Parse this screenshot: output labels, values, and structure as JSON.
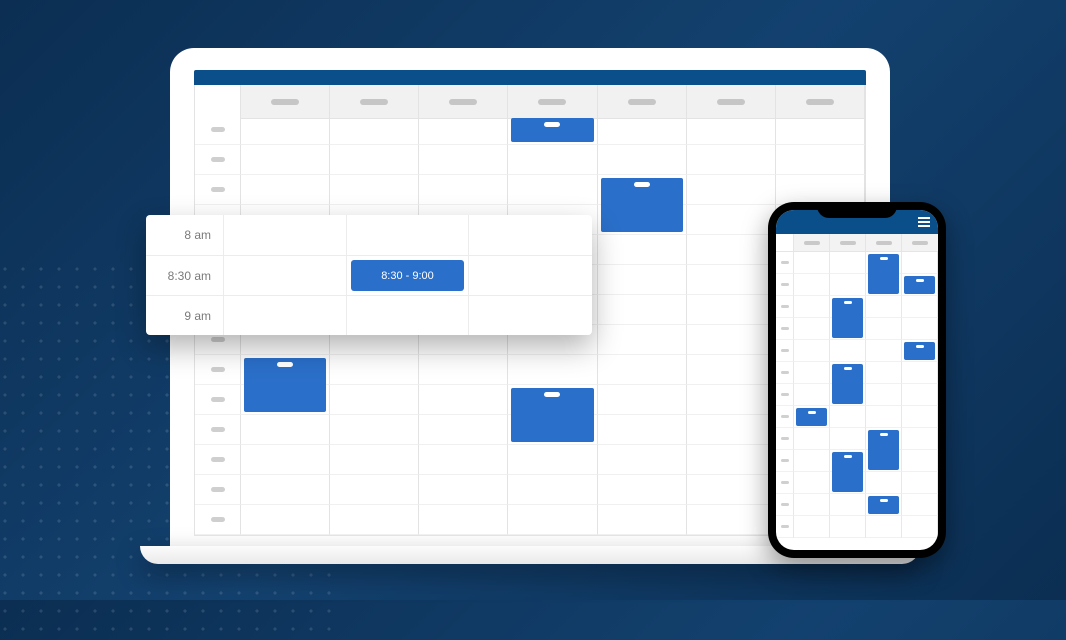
{
  "colors": {
    "brand": "#0b4f8a",
    "event": "#2a6fc9"
  },
  "zoom": {
    "rows": [
      "8 am",
      "8:30 am",
      "9 am"
    ],
    "event_label": "8:30 - 9:00"
  },
  "laptop": {
    "time_rows": 14,
    "day_cols": 7,
    "events": [
      {
        "row": 1,
        "col": 4,
        "span": 1
      },
      {
        "row": 3,
        "col": 5,
        "span": 2
      },
      {
        "row": 7,
        "col": 3,
        "span": 1
      },
      {
        "row": 8,
        "col": 7,
        "span": 2
      },
      {
        "row": 9,
        "col": 1,
        "span": 2
      },
      {
        "row": 10,
        "col": 4,
        "span": 2
      }
    ]
  },
  "phone": {
    "time_rows": 13,
    "day_cols": 4,
    "events": [
      {
        "row": 1,
        "col": 3,
        "span": 2
      },
      {
        "row": 2,
        "col": 4,
        "span": 1
      },
      {
        "row": 3,
        "col": 2,
        "span": 2
      },
      {
        "row": 5,
        "col": 4,
        "span": 1
      },
      {
        "row": 6,
        "col": 2,
        "span": 2
      },
      {
        "row": 8,
        "col": 1,
        "span": 1
      },
      {
        "row": 9,
        "col": 3,
        "span": 2
      },
      {
        "row": 10,
        "col": 2,
        "span": 2
      },
      {
        "row": 12,
        "col": 3,
        "span": 1
      }
    ]
  }
}
